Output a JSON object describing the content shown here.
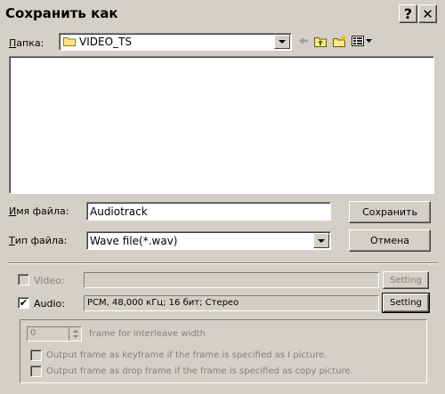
{
  "window": {
    "title": "Сохранить как"
  },
  "titlebar": {
    "help_glyph": "?",
    "close_glyph": "✕"
  },
  "location": {
    "label_prefix": "П",
    "label_rest": "апка:",
    "folder": "VIDEO_TS"
  },
  "filename": {
    "label_prefix": "И",
    "label_rest": "мя файла:",
    "value": "Audiotrack"
  },
  "filetype": {
    "label_prefix": "Т",
    "label_rest": "ип файла:",
    "value": "Wave file(*.wav)"
  },
  "buttons": {
    "save": "Сохранить",
    "cancel": "Отмена"
  },
  "video": {
    "label": "Video:",
    "value": "",
    "setting": "Setting"
  },
  "audio": {
    "label": "Audio:",
    "value": "PCM, 48,000 кГц; 16 бит; Стерео",
    "setting": "Setting",
    "checked": true
  },
  "interleave": {
    "value": "0",
    "label": "frame for interleave width"
  },
  "options": [
    "Output frame as keyframe if the frame is specified as I picture.",
    "Output frame as drop frame if the frame is specified as copy picture."
  ]
}
